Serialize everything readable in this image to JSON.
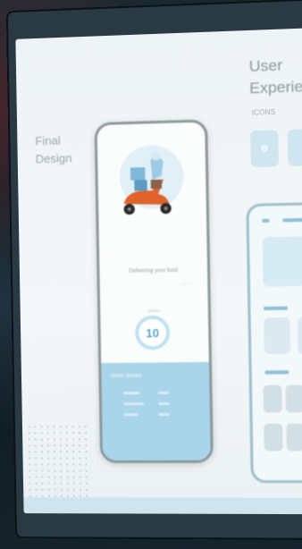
{
  "screen": {
    "final_design_label": "Final\nDesign",
    "ux_title": "User\nExperie",
    "icons_label": "ICONS"
  },
  "phone": {
    "caption": "Delivering your food",
    "caption_sub": "...........",
    "timer_label": "minutes",
    "timer_value": "10",
    "panel_title": "Order details"
  },
  "colors": {
    "accent_blue": "#a9d5ea",
    "scooter_orange": "#e0632b",
    "screen_bg": "#eef3f5"
  }
}
